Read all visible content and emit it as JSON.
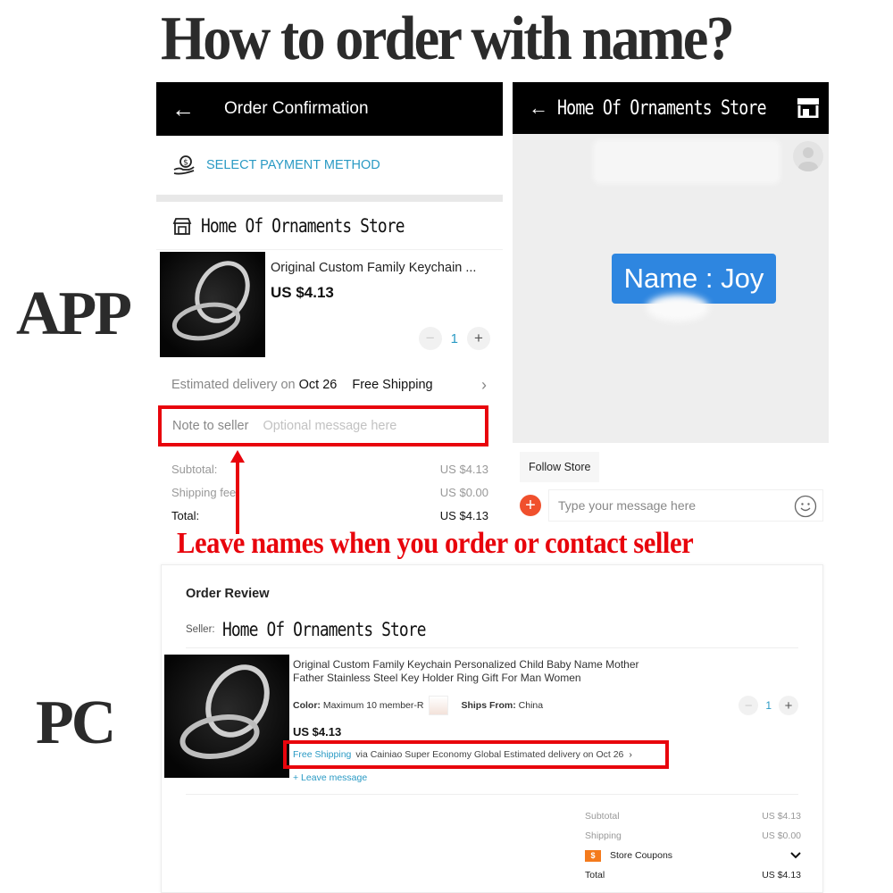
{
  "title": "How to order with name?",
  "side_labels": {
    "app": "APP",
    "pc": "PC"
  },
  "caption": "Leave names when you order or contact seller",
  "colors": {
    "accent_red": "#e8040c",
    "link_blue": "#2a9ac4",
    "bubble_blue": "#2e86e0",
    "coupon_orange": "#f47a1c"
  },
  "app_order": {
    "header_title": "Order Confirmation",
    "back_icon": "arrow-left-icon",
    "payment_label": "SELECT PAYMENT METHOD",
    "store_name": "Home Of Ornaments Store",
    "product": {
      "name": "Original Custom Family Keychain ...",
      "price": "US $4.13",
      "quantity": "1"
    },
    "delivery": {
      "label": "Estimated delivery on",
      "date": "Oct 26",
      "shipping": "Free Shipping"
    },
    "note": {
      "label": "Note to seller",
      "placeholder": "Optional message here"
    },
    "summary": [
      {
        "label": "Subtotal:",
        "value": "US $4.13"
      },
      {
        "label": "Shipping fee:",
        "value": "US $0.00"
      },
      {
        "label": "Total:",
        "value": "US $4.13"
      }
    ]
  },
  "app_chat": {
    "header_title": "Home Of Ornaments Store",
    "back_icon": "arrow-left-icon",
    "store_icon": "shop-icon",
    "message": "Name : Joy",
    "follow_label": "Follow Store",
    "input_placeholder": "Type your message here"
  },
  "pc_order": {
    "title": "Order Review",
    "seller_label": "Seller:",
    "seller_name": "Home Of Ornaments Store",
    "product": {
      "name": "Original Custom Family Keychain Personalized Child Baby Name Mother Father Stainless Steel Key Holder Ring Gift For Man Women",
      "color_label": "Color:",
      "color_value": "Maximum 10 member-R",
      "ships_from_label": "Ships From:",
      "ships_from_value": "China",
      "price": "US $4.13",
      "quantity": "1"
    },
    "shipping": {
      "free": "Free Shipping",
      "via": "via Cainiao Super Economy Global",
      "estimate": "Estimated delivery on Oct 26"
    },
    "leave_message": "+ Leave message",
    "totals": {
      "subtotal_label": "Subtotal",
      "subtotal_value": "US $4.13",
      "shipping_label": "Shipping",
      "shipping_value": "US $0.00",
      "coupons_label": "Store Coupons",
      "coupon_icon_text": "$",
      "total_label": "Total",
      "total_value": "US $4.13"
    }
  }
}
